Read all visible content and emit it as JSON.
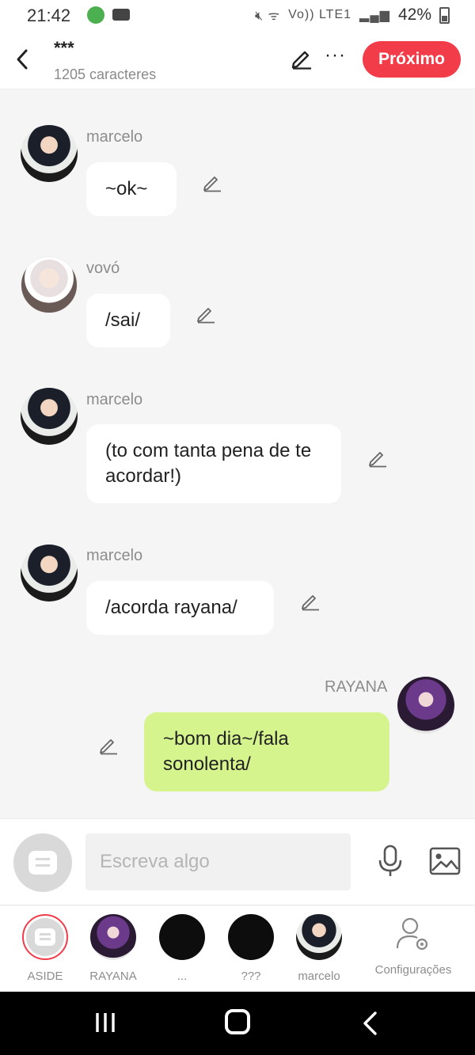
{
  "status_bar": {
    "time": "21:42",
    "battery": "42%",
    "network": "Vo)) LTE1"
  },
  "header": {
    "title": "***",
    "subtitle": "1205 caracteres",
    "next_label": "Próximo"
  },
  "messages": [
    {
      "sender": "marcelo",
      "text": "~ok~",
      "avatar": "marcelo-avatar",
      "mine": false
    },
    {
      "sender": "vovó",
      "text": "/sai/",
      "avatar": "vovo-avatar",
      "mine": false
    },
    {
      "sender": "marcelo",
      "text": "(to com tanta pena de te acordar!)",
      "avatar": "marcelo-avatar",
      "mine": false
    },
    {
      "sender": "marcelo",
      "text": "/acorda rayana/",
      "avatar": "marcelo-avatar",
      "mine": false
    },
    {
      "sender": "RAYANA",
      "text": "~bom dia~/fala sonolenta/",
      "avatar": "rayana-avatar",
      "mine": true
    }
  ],
  "composer": {
    "placeholder": "Escreva algo"
  },
  "roles": [
    {
      "label": "ASIDE",
      "icon": "chat-bubble-icon"
    },
    {
      "label": "RAYANA",
      "icon": "rayana-avatar"
    },
    {
      "label": "...",
      "icon": "black-avatar"
    },
    {
      "label": "???",
      "icon": "black-avatar"
    },
    {
      "label": "marcelo",
      "icon": "marcelo-avatar"
    },
    {
      "label": "Configurações",
      "icon": "user-settings-icon"
    }
  ],
  "colors": {
    "accent": "#f23c4a",
    "my_bubble": "#d6f48e",
    "background": "#f5f5f5"
  }
}
